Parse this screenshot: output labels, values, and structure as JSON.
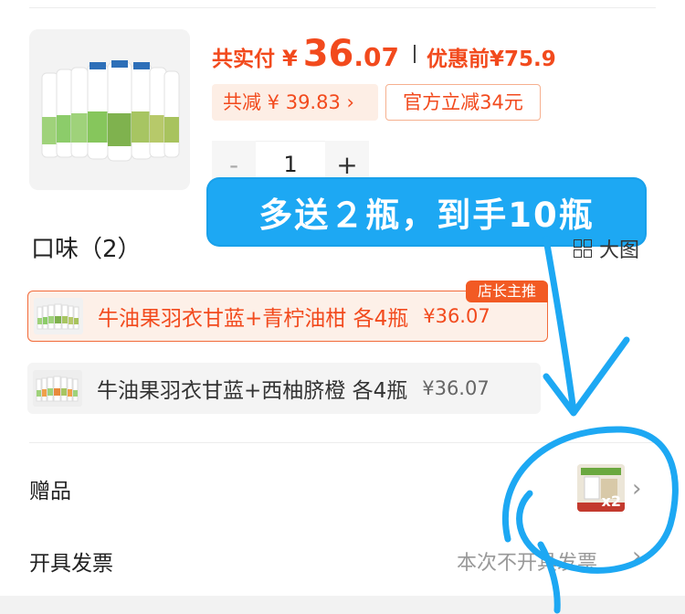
{
  "product": {
    "total_label": "共实付",
    "currency": "¥",
    "price_int": "36",
    "price_dec": ".07",
    "original_label": "优惠前",
    "original_price": "¥75.9",
    "saved_text": "共减 ¥ 39.83 ›",
    "official_discount": "官方立减34元"
  },
  "quantity": {
    "minus": "-",
    "value": "1",
    "plus": "+"
  },
  "promo_bubble": "多送２瓶，到手10瓶",
  "flavor": {
    "title": "口味（2）",
    "view_toggle": "大图",
    "options": [
      {
        "name": "牛油果羽衣甘蓝+青柠油柑  各4瓶",
        "price": "¥36.07",
        "badge": "店长主推",
        "selected": true
      },
      {
        "name": "牛油果羽衣甘蓝+西柚脐橙  各4瓶",
        "price": "¥36.07",
        "selected": false
      }
    ]
  },
  "gift": {
    "label": "赠品",
    "qty": "x2",
    "chevron": "›"
  },
  "invoice": {
    "label": "开具发票",
    "value": "本次不开具发票",
    "chevron": "›"
  },
  "colors": {
    "accent": "#f24a1d",
    "annotation": "#1da8f3"
  }
}
